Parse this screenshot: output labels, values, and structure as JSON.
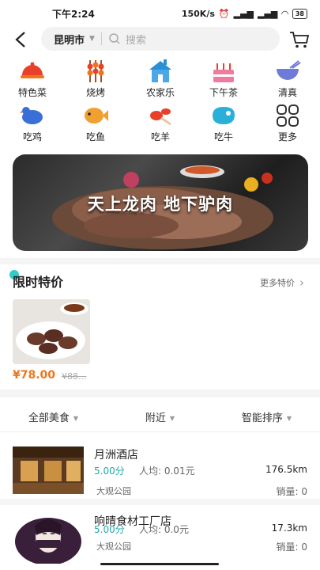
{
  "status": {
    "time": "下午2:24",
    "speed": "150K/s",
    "battery": "38"
  },
  "header": {
    "city": "昆明市",
    "search_placeholder": "搜索"
  },
  "categories": [
    {
      "label": "特色菜",
      "icon": "dish-icon"
    },
    {
      "label": "烧烤",
      "icon": "skewer-icon"
    },
    {
      "label": "农家乐",
      "icon": "farmhouse-icon"
    },
    {
      "label": "下午茶",
      "icon": "cake-icon"
    },
    {
      "label": "清真",
      "icon": "bowl-icon"
    },
    {
      "label": "吃鸡",
      "icon": "chicken-icon"
    },
    {
      "label": "吃鱼",
      "icon": "fish-icon"
    },
    {
      "label": "吃羊",
      "icon": "lamb-icon"
    },
    {
      "label": "吃牛",
      "icon": "beef-icon"
    },
    {
      "label": "更多",
      "icon": "grid-more-icon"
    }
  ],
  "banner": {
    "slogan": "天上龙肉 地下驴肉"
  },
  "flash_sale": {
    "title": "限时特价",
    "more": "更多特价",
    "item": {
      "price": "¥78.00",
      "old_price": "¥88..."
    }
  },
  "filters": {
    "all": "全部美食",
    "nearby": "附近",
    "sort": "智能排序"
  },
  "shops": [
    {
      "name": "月洲酒店",
      "rating": "5.00分",
      "avg": "人均: 0.01元",
      "area": "大观公园",
      "distance": "176.5km",
      "sales": "销量: 0"
    },
    {
      "name": "响晴食材工厂店",
      "rating": "5.00分",
      "avg": "人均: 0.0元",
      "area": "大观公园",
      "distance": "17.3km",
      "sales": "销量: 0"
    }
  ],
  "colors": {
    "accent": "#21a9a5",
    "price": "#f0741a"
  }
}
